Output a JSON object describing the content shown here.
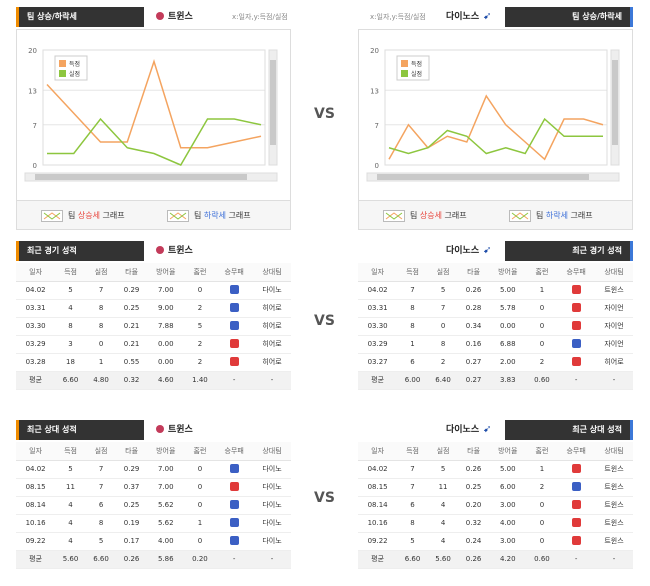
{
  "trend": {
    "left": {
      "title": "팀 상승/하락세",
      "team": "트윈스",
      "axis": "x:일자,y:득점/실점",
      "y_ticks": [
        "20",
        "13",
        "7",
        "0"
      ],
      "legend": {
        "scored": "득점",
        "conceded": "실점"
      },
      "scored": [
        14,
        9,
        4,
        4,
        18,
        3,
        3,
        4,
        5
      ],
      "conceded": [
        2,
        2,
        8,
        3,
        2,
        0,
        8,
        8,
        7
      ]
    },
    "right": {
      "title": "팀 상승/하락세",
      "team": "다이노스",
      "axis": "x:일자,y:득점/실점",
      "y_ticks": [
        "20",
        "13",
        "7",
        "0"
      ],
      "legend": {
        "scored": "득점",
        "conceded": "실점"
      },
      "scored": [
        1,
        7,
        3,
        5,
        4,
        12,
        7,
        4,
        1,
        8,
        8,
        7
      ],
      "conceded": [
        3,
        2,
        3,
        6,
        5,
        2,
        3,
        2,
        8,
        5,
        5,
        5
      ]
    },
    "legend_left": {
      "prefix": "팀 ",
      "up": "상승세",
      "suffix": " 그래프"
    },
    "legend_right": {
      "prefix": "팀 ",
      "down": "하락세",
      "suffix": " 그래프"
    },
    "colors": {
      "scored": "#f4a460",
      "conceded": "#8dc63f"
    }
  },
  "vs": "VS",
  "columns": [
    "일자",
    "득점",
    "실점",
    "타율",
    "방어율",
    "홈런",
    "승무패",
    "상대팀"
  ],
  "recent": {
    "title": "최근 경기 성적",
    "left": {
      "team": "트윈스",
      "rows": [
        [
          "04.02",
          "5",
          "7",
          "0.29",
          "7.00",
          "0",
          "W",
          "다이노"
        ],
        [
          "03.31",
          "4",
          "8",
          "0.25",
          "9.00",
          "2",
          "W",
          "히어로"
        ],
        [
          "03.30",
          "8",
          "8",
          "0.21",
          "7.88",
          "5",
          "W",
          "히어로"
        ],
        [
          "03.29",
          "3",
          "0",
          "0.21",
          "0.00",
          "2",
          "L",
          "히어로"
        ],
        [
          "03.28",
          "18",
          "1",
          "0.55",
          "0.00",
          "2",
          "L",
          "히어로"
        ]
      ],
      "avg": [
        "평균",
        "6.60",
        "4.80",
        "0.32",
        "4.60",
        "1.40",
        "-",
        "-"
      ]
    },
    "right": {
      "team": "다이노스",
      "rows": [
        [
          "04.02",
          "7",
          "5",
          "0.26",
          "5.00",
          "1",
          "L",
          "트윈스"
        ],
        [
          "03.31",
          "8",
          "7",
          "0.28",
          "5.78",
          "0",
          "L",
          "자이언"
        ],
        [
          "03.30",
          "8",
          "0",
          "0.34",
          "0.00",
          "0",
          "L",
          "자이언"
        ],
        [
          "03.29",
          "1",
          "8",
          "0.16",
          "6.88",
          "0",
          "W",
          "자이언"
        ],
        [
          "03.27",
          "6",
          "2",
          "0.27",
          "2.00",
          "2",
          "L",
          "히어로"
        ]
      ],
      "avg": [
        "평균",
        "6.00",
        "6.40",
        "0.27",
        "3.83",
        "0.60",
        "-",
        "-"
      ]
    }
  },
  "h2h": {
    "title": "최근 상대 성적",
    "left": {
      "team": "트윈스",
      "rows": [
        [
          "04.02",
          "5",
          "7",
          "0.29",
          "7.00",
          "0",
          "W",
          "다이노"
        ],
        [
          "08.15",
          "11",
          "7",
          "0.37",
          "7.00",
          "0",
          "L",
          "다이노"
        ],
        [
          "08.14",
          "4",
          "6",
          "0.25",
          "5.62",
          "0",
          "W",
          "다이노"
        ],
        [
          "10.16",
          "4",
          "8",
          "0.19",
          "5.62",
          "1",
          "W",
          "다이노"
        ],
        [
          "09.22",
          "4",
          "5",
          "0.17",
          "4.00",
          "0",
          "W",
          "다이노"
        ]
      ],
      "avg": [
        "평균",
        "5.60",
        "6.60",
        "0.26",
        "5.86",
        "0.20",
        "-",
        "-"
      ]
    },
    "right": {
      "team": "다이노스",
      "rows": [
        [
          "04.02",
          "7",
          "5",
          "0.26",
          "5.00",
          "1",
          "L",
          "트윈스"
        ],
        [
          "08.15",
          "7",
          "11",
          "0.25",
          "6.00",
          "2",
          "W",
          "트윈스"
        ],
        [
          "08.14",
          "6",
          "4",
          "0.20",
          "3.00",
          "0",
          "L",
          "트윈스"
        ],
        [
          "10.16",
          "8",
          "4",
          "0.32",
          "4.00",
          "0",
          "L",
          "트윈스"
        ],
        [
          "09.22",
          "5",
          "4",
          "0.24",
          "3.00",
          "0",
          "L",
          "트윈스"
        ]
      ],
      "avg": [
        "평균",
        "6.60",
        "5.60",
        "0.26",
        "4.20",
        "0.60",
        "-",
        "-"
      ]
    }
  }
}
